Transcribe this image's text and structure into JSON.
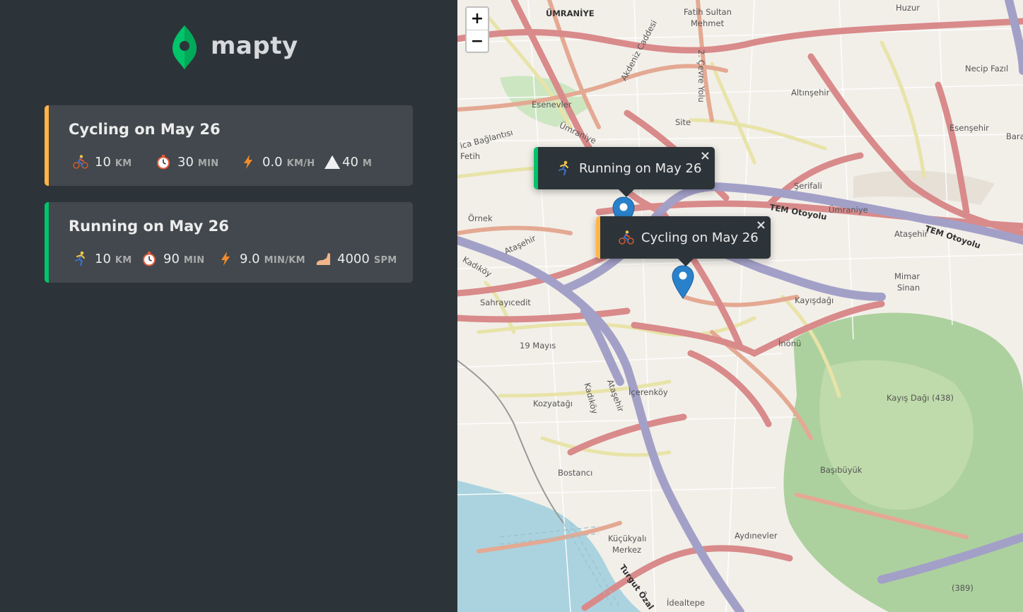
{
  "app": {
    "logo_text": "mapty"
  },
  "workouts": [
    {
      "type": "cycling",
      "title": "Cycling on May 26",
      "distance": {
        "value": "10",
        "unit": "KM"
      },
      "duration": {
        "value": "30",
        "unit": "MIN"
      },
      "speed": {
        "value": "0.0",
        "unit": "KM/H"
      },
      "elevation": {
        "value": "40",
        "unit": "M"
      }
    },
    {
      "type": "running",
      "title": "Running on May 26",
      "distance": {
        "value": "10",
        "unit": "KM"
      },
      "duration": {
        "value": "90",
        "unit": "MIN"
      },
      "pace": {
        "value": "9.0",
        "unit": "MIN/KM"
      },
      "cadence": {
        "value": "4000",
        "unit": "SPM"
      }
    }
  ],
  "map": {
    "zoom_in": "+",
    "zoom_out": "−",
    "popups": [
      {
        "type": "running",
        "text": "Running on May 26",
        "close": "×"
      },
      {
        "type": "cycling",
        "text": "Cycling on May 26",
        "close": "×"
      }
    ],
    "place_labels": [
      "ÜMRANİYE",
      "Fatih Sultan",
      "Mehmet",
      "Huzur",
      "Necip Fazıl",
      "Altınşehir",
      "Esenevler",
      "Akdeniz Caddesi",
      "2. Çevre Yolu",
      "Site",
      "Ümraniye",
      "Esenşehir",
      "Bara",
      "ica Bağlantısı",
      "Fetih",
      "Şerifali",
      "TEM Otoyolu",
      "Ümraniye",
      "Ataşehir",
      "TEM Otoyolu",
      "Örnek",
      "Kadıköy",
      "Ataşehir",
      "Mimar",
      "Sinan",
      "Sahrayıcedit",
      "Kayışdağı",
      "İnönü",
      "19 Mayıs",
      "Kadıköy",
      "Ataşehir",
      "İçerenköy",
      "Kozyatağı",
      "Kayış Dağı (438)",
      "Başıbüyük",
      "Bostancı",
      "Küçükyalı",
      "Merkez",
      "Aydınevler",
      "Turgut Özal",
      "İdealtepe",
      "(389)"
    ]
  },
  "colors": {
    "sidebar_bg": "#2d3439",
    "card_bg": "#42484d",
    "running_accent": "#00c46a",
    "cycling_accent": "#ffb545",
    "marker_blue": "#2a81cb"
  },
  "icons": [
    "logo-pin-icon",
    "cyclist-icon",
    "runner-icon",
    "stopwatch-icon",
    "lightning-icon",
    "mountain-icon",
    "foot-icon",
    "map-marker-icon",
    "close-icon"
  ]
}
